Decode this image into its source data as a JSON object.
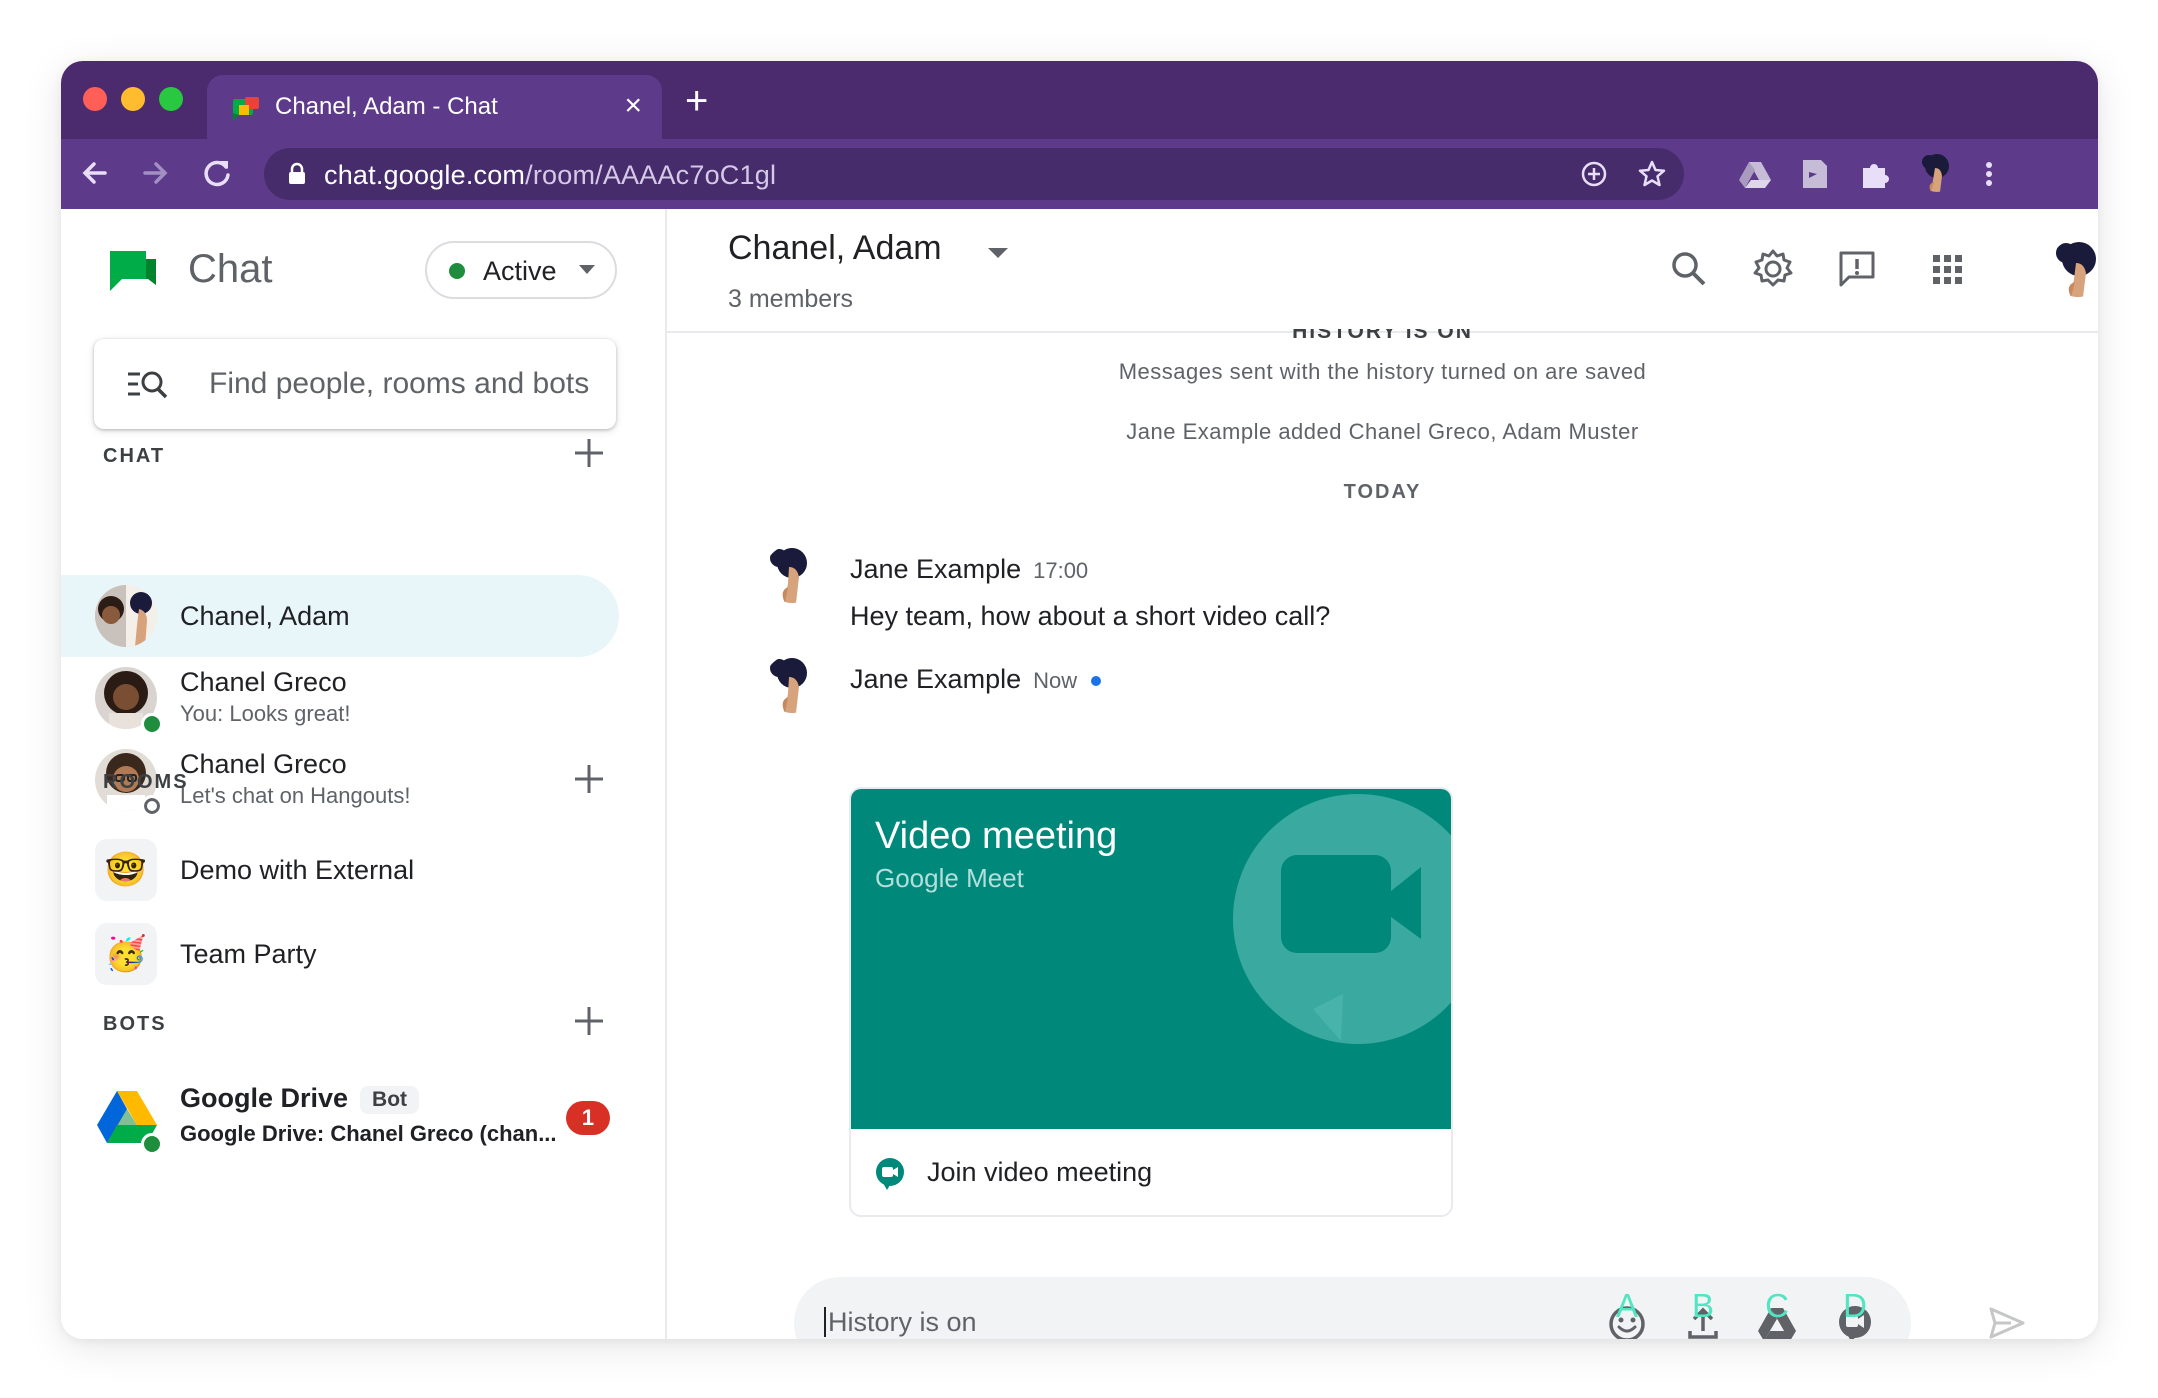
{
  "browser": {
    "tab_title": "Chanel, Adam - Chat",
    "tab_close": "×",
    "new_tab": "+",
    "url_host": "chat.google.com",
    "url_path": "/room/AAAAc7oC1gl"
  },
  "sidebar": {
    "brand": "Chat",
    "status": "Active",
    "search_placeholder": "Find people, rooms and bots",
    "chat_section": "CHAT",
    "chat_items": [
      {
        "title": "Chanel, Adam",
        "subtitle": ""
      },
      {
        "title": "Chanel Greco",
        "subtitle": "You: Looks great!"
      },
      {
        "title": "Chanel Greco",
        "subtitle": "Let's chat on Hangouts!"
      }
    ],
    "rooms_section": "ROOMS",
    "rooms": [
      {
        "title": "Demo with External",
        "emoji": "🤓"
      },
      {
        "title": "Team Party",
        "emoji": "🥳"
      }
    ],
    "bots_section": "BOTS",
    "bots": [
      {
        "title": "Google Drive",
        "badge": "Bot",
        "subtitle": "Google Drive: Chanel Greco (chan...",
        "unread": "1"
      }
    ]
  },
  "room": {
    "title": "Chanel, Adam",
    "members": "3 members",
    "history_heading": "HISTORY IS ON",
    "history_notice": "Messages sent with the history turned on are saved",
    "added_notice": "Jane Example added Chanel Greco, Adam Muster",
    "day_divider": "TODAY",
    "messages": [
      {
        "sender": "Jane Example",
        "time": "17:00",
        "text": "Hey team, how about a short video call?"
      },
      {
        "sender": "Jane Example",
        "time": "Now",
        "text": ""
      }
    ],
    "card": {
      "title": "Video meeting",
      "subtitle": "Google Meet",
      "action": "Join video meeting"
    }
  },
  "composer": {
    "placeholder": "History is on",
    "labels": [
      "A",
      "B",
      "C",
      "D"
    ],
    "icons": [
      "emoji-icon",
      "upload-icon",
      "drive-icon",
      "meet-icon"
    ]
  },
  "colors": {
    "titlebar": "#4b2a6e",
    "toolbar": "#5d3b8a",
    "card": "#00897b",
    "status_active": "#1e8e3e",
    "selected_row": "#e8f6fa",
    "annotation": "#52e5c2",
    "unread": "#d93025"
  }
}
